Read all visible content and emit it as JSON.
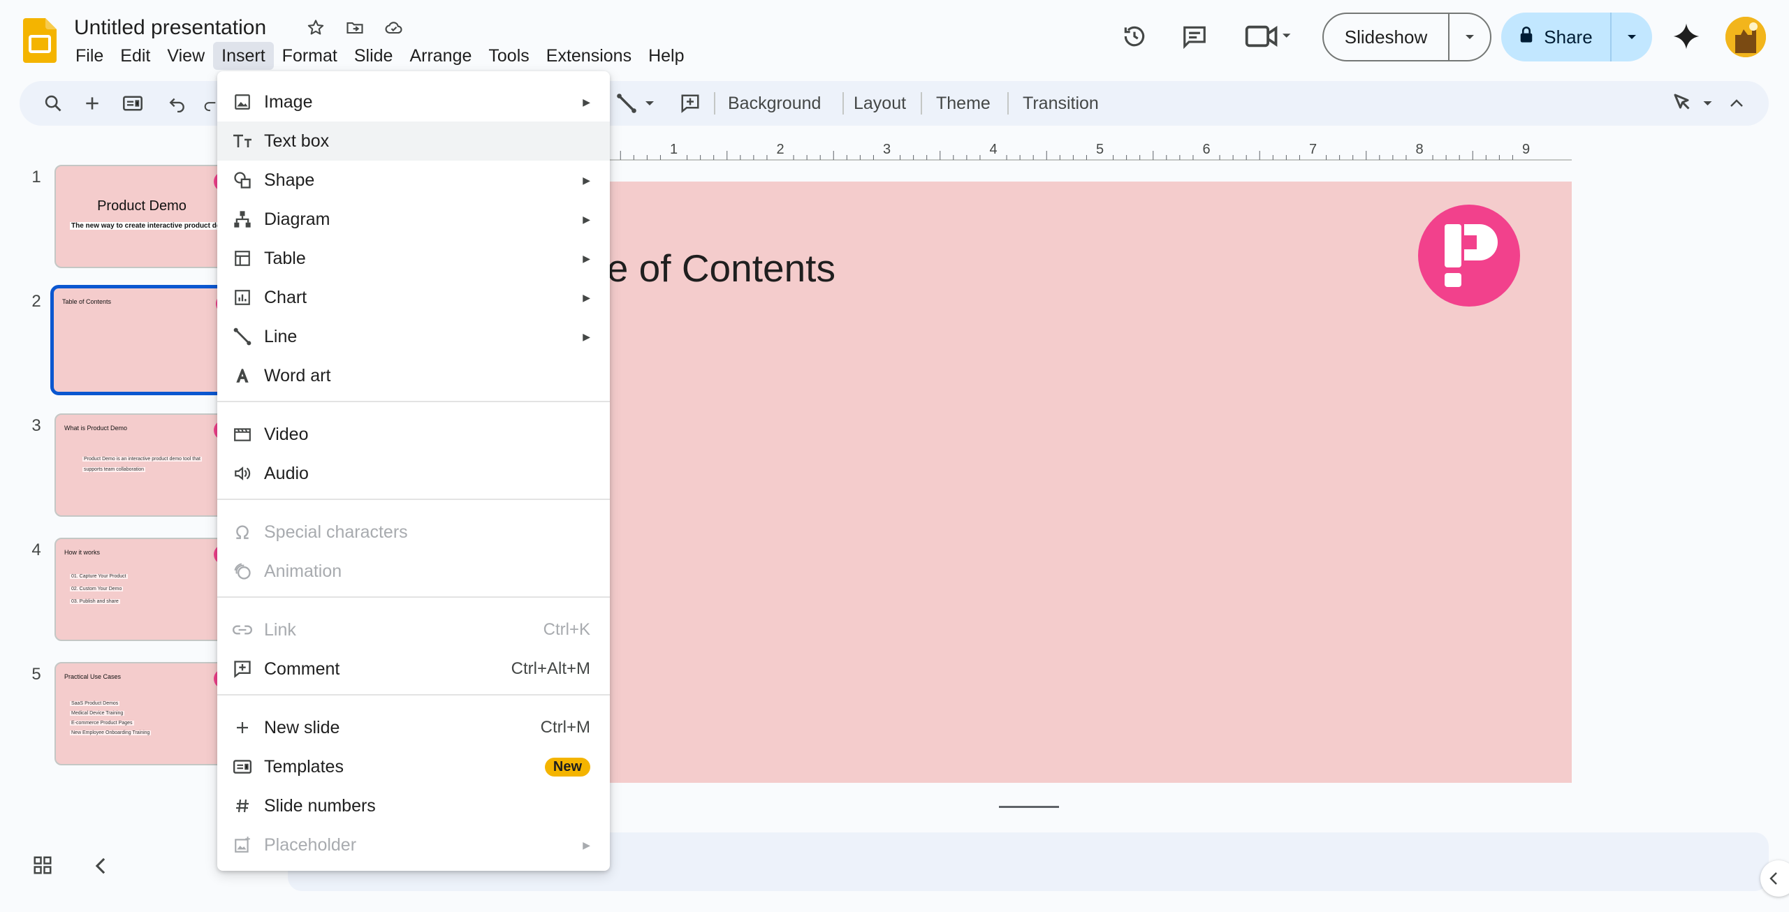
{
  "app": {
    "title": "Untitled presentation"
  },
  "menubar": {
    "items": [
      "File",
      "Edit",
      "View",
      "Insert",
      "Format",
      "Slide",
      "Arrange",
      "Tools",
      "Extensions",
      "Help"
    ],
    "active": "Insert"
  },
  "header": {
    "slideshow_label": "Slideshow",
    "share_label": "Share",
    "icons": [
      "star-icon",
      "move-to-folder-icon",
      "cloud-saved-icon",
      "version-history-icon",
      "comments-icon",
      "meet-icon",
      "gemini-icon"
    ]
  },
  "toolbar": {
    "background_label": "Background",
    "layout_label": "Layout",
    "theme_label": "Theme",
    "transition_label": "Transition"
  },
  "ruler": {
    "labels": [
      "1",
      "2",
      "3",
      "4",
      "5",
      "6",
      "7",
      "8",
      "9"
    ]
  },
  "slides": [
    {
      "num": "1",
      "title": "Product Demo",
      "subtitle": "The new way to create interactive product demo"
    },
    {
      "num": "2",
      "title": "Table of Contents"
    },
    {
      "num": "3",
      "title": "What is Product Demo",
      "body": [
        "Product Demo is an interactive product demo tool that",
        "supports team collaboration"
      ]
    },
    {
      "num": "4",
      "title": "How it works",
      "body": [
        "01. Capture Your Product",
        "02. Custom Your Demo",
        "03. Publish and share"
      ]
    },
    {
      "num": "5",
      "title": "Practical Use Cases",
      "body": [
        "SaaS Product Demos",
        "Medical Device Training",
        "E-commerce Product Pages",
        "New Employee Onboarding Training"
      ]
    }
  ],
  "current_slide": {
    "title_visible": "ble of Contents"
  },
  "insert_menu": {
    "image": "Image",
    "text_box": "Text box",
    "shape": "Shape",
    "diagram": "Diagram",
    "table": "Table",
    "chart": "Chart",
    "line": "Line",
    "word_art": "Word art",
    "video": "Video",
    "audio": "Audio",
    "special_characters": "Special characters",
    "animation": "Animation",
    "link": "Link",
    "link_shortcut": "Ctrl+K",
    "comment": "Comment",
    "comment_shortcut": "Ctrl+Alt+M",
    "new_slide": "New slide",
    "new_slide_shortcut": "Ctrl+M",
    "templates": "Templates",
    "templates_badge": "New",
    "slide_numbers": "Slide numbers",
    "placeholder": "Placeholder"
  },
  "colors": {
    "accent_blue": "#0b57d0",
    "share_bg": "#c2e7ff",
    "slide_bg": "#f4cccc",
    "logo_pink": "#f2418c",
    "badge_yellow": "#f4b400"
  }
}
